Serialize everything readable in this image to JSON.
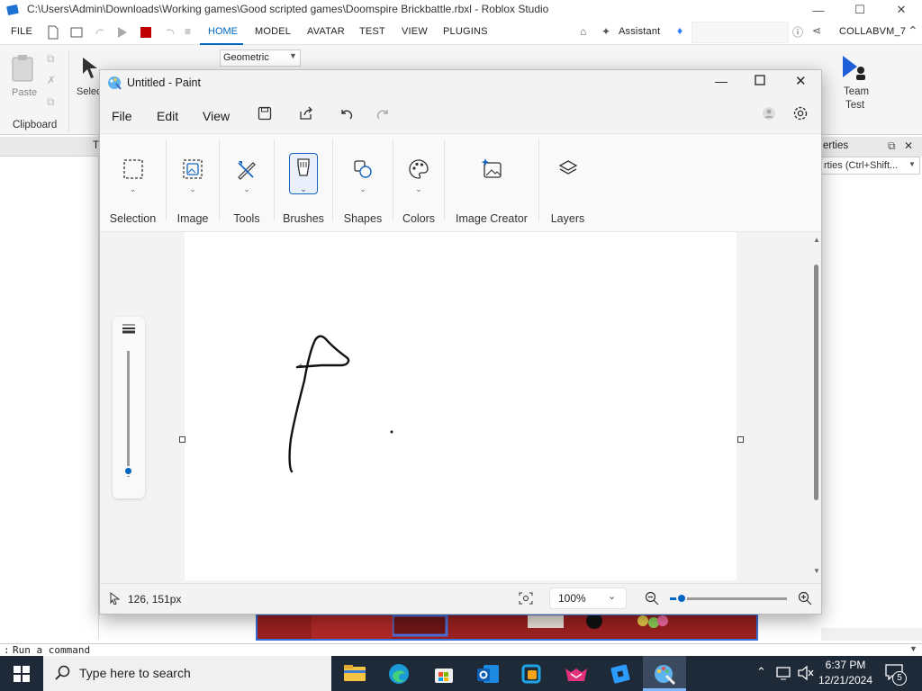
{
  "studio": {
    "title": "C:\\Users\\Admin\\Downloads\\Working games\\Good scripted games\\Doomspire Brickbattle.rbxl - Roblox Studio",
    "menu": [
      "FILE",
      "HOME",
      "MODEL",
      "AVATAR",
      "TEST",
      "VIEW",
      "PLUGINS"
    ],
    "assistant": "Assistant",
    "user": "COLLABVM_7",
    "dropdown_value": "Geometric",
    "paste": "Paste",
    "clipboard": "Clipboard",
    "select_partial": "Selec",
    "team_test": "Team",
    "team_test2": "Test",
    "tab_partial": "T",
    "properties_title": "erties",
    "properties_filter": "rties (Ctrl+Shift...",
    "command_placeholder": "Run a command"
  },
  "paint": {
    "title": "Untitled - Paint",
    "menu": [
      "File",
      "Edit",
      "View"
    ],
    "tools": {
      "selection": "Selection",
      "image": "Image",
      "tools": "Tools",
      "brushes": "Brushes",
      "shapes": "Shapes",
      "colors": "Colors",
      "image_creator": "Image Creator",
      "layers": "Layers"
    },
    "status": {
      "coords": "126, 151px",
      "zoom": "100%",
      "zoom_slider": 0.1,
      "brush_size": 0.04
    }
  },
  "taskbar": {
    "search_placeholder": "Type here to search",
    "time": "6:37 PM",
    "date": "12/21/2024",
    "notifications": "5"
  },
  "colors": {
    "accent": "#0067c0",
    "taskbar": "#1f2a38",
    "stop_red": "#c00000"
  }
}
